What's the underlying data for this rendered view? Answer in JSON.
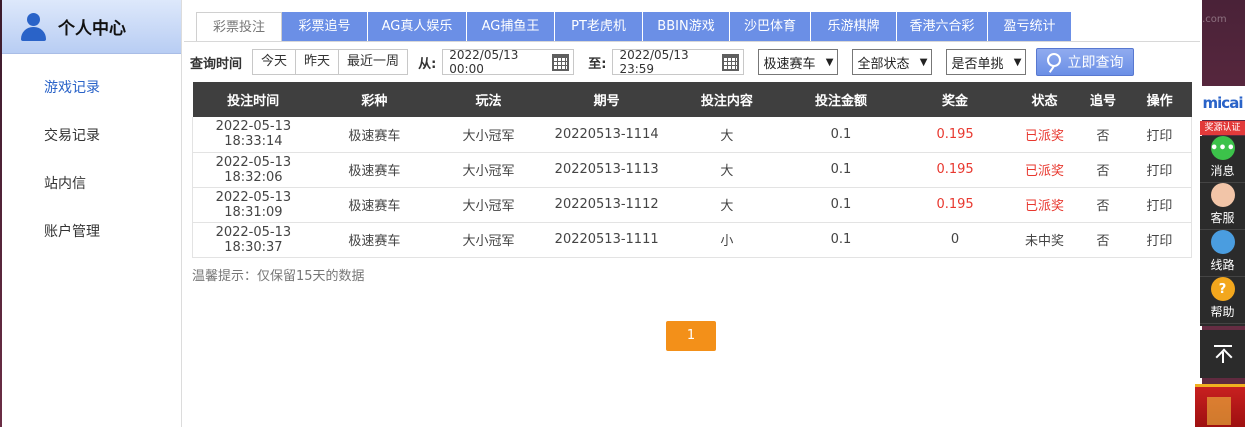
{
  "sidebar": {
    "title": "个人中心",
    "items": [
      {
        "label": "游戏记录",
        "active": true
      },
      {
        "label": "交易记录",
        "active": false
      },
      {
        "label": "站内信",
        "active": false
      },
      {
        "label": "账户管理",
        "active": false
      }
    ]
  },
  "tabs": [
    {
      "label": "彩票投注",
      "active": true
    },
    {
      "label": "彩票追号",
      "active": false
    },
    {
      "label": "AG真人娱乐",
      "active": false
    },
    {
      "label": "AG捕鱼王",
      "active": false
    },
    {
      "label": "PT老虎机",
      "active": false
    },
    {
      "label": "BBIN游戏",
      "active": false
    },
    {
      "label": "沙巴体育",
      "active": false
    },
    {
      "label": "乐游棋牌",
      "active": false
    },
    {
      "label": "香港六合彩",
      "active": false
    },
    {
      "label": "盈亏统计",
      "active": false
    }
  ],
  "filter": {
    "label": "查询时间",
    "quick": [
      "今天",
      "昨天",
      "最近一周"
    ],
    "from_label": "从:",
    "from_value": "2022/05/13 00:00",
    "to_label": "至:",
    "to_value": "2022/05/13 23:59",
    "game_select": "极速赛车",
    "status_select": "全部状态",
    "single_select": "是否单挑",
    "search_label": "立即查询"
  },
  "table": {
    "headers": [
      "投注时间",
      "彩种",
      "玩法",
      "期号",
      "投注内容",
      "投注金额",
      "奖金",
      "状态",
      "追号",
      "操作"
    ],
    "rows": [
      {
        "time": "2022-05-13 18:33:14",
        "game": "极速赛车",
        "play": "大小冠军",
        "issue": "20220513-1114",
        "content": "大",
        "amount": "0.1",
        "prize": "0.195",
        "status": "已派奖",
        "chase": "否",
        "action": "打印",
        "won": true
      },
      {
        "time": "2022-05-13 18:32:06",
        "game": "极速赛车",
        "play": "大小冠军",
        "issue": "20220513-1113",
        "content": "大",
        "amount": "0.1",
        "prize": "0.195",
        "status": "已派奖",
        "chase": "否",
        "action": "打印",
        "won": true
      },
      {
        "time": "2022-05-13 18:31:09",
        "game": "极速赛车",
        "play": "大小冠军",
        "issue": "20220513-1112",
        "content": "大",
        "amount": "0.1",
        "prize": "0.195",
        "status": "已派奖",
        "chase": "否",
        "action": "打印",
        "won": true
      },
      {
        "time": "2022-05-13 18:30:37",
        "game": "极速赛车",
        "play": "大小冠军",
        "issue": "20220513-1111",
        "content": "小",
        "amount": "0.1",
        "prize": "0",
        "status": "未中奖",
        "chase": "否",
        "action": "打印",
        "won": false
      }
    ]
  },
  "tip": "温馨提示：仅保留15天的数据",
  "pagination": {
    "current": "1"
  },
  "right_bar": {
    "logo_text": "micai",
    "badge": "奖源认证",
    "items": [
      {
        "label": "消息",
        "icon": "chat-icon"
      },
      {
        "label": "客服",
        "icon": "customer-service-icon"
      },
      {
        "label": "线路",
        "icon": "speedometer-icon"
      },
      {
        "label": "帮助",
        "icon": "help-icon",
        "glyph": "?"
      }
    ]
  },
  "watermark": "回家74.com",
  "colors": {
    "accent": "#6b8fe6",
    "header_dark": "#3f3f3f",
    "win": "#e8382f",
    "pager": "#f39019"
  }
}
